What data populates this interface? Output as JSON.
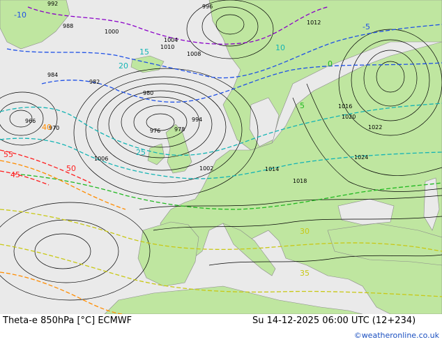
{
  "footer": {
    "title": "Theta-e 850hPa [°C] ECMWF",
    "valid_time": "Su 14-12-2025 06:00 UTC (12+234)",
    "credit": "©weatheronline.co.uk"
  },
  "colors": {
    "land": "#bfe6a0",
    "sea": "#eaeaea",
    "isobar": "#000000",
    "theta_cold": "#8a00c8",
    "theta_cool": "#1e50e6",
    "theta_mid": "#14b4b4",
    "theta_mild": "#20b820",
    "theta_warm": "#c8c814",
    "theta_hot": "#ff8c00",
    "theta_very_hot": "#ff1e1e"
  },
  "pressure_labels": [
    "992",
    "996",
    "1000",
    "1004",
    "1008",
    "1010",
    "1012",
    "1016",
    "1020",
    "1024",
    "1022",
    "1018",
    "1014",
    "984",
    "988",
    "980",
    "976",
    "966",
    "970",
    "978",
    "982",
    "994",
    "1002",
    "1006"
  ],
  "theta_labels": [
    "-10",
    "-5",
    "0",
    "5",
    "10",
    "15",
    "20",
    "25",
    "30",
    "35",
    "40",
    "45",
    "50",
    "55"
  ]
}
